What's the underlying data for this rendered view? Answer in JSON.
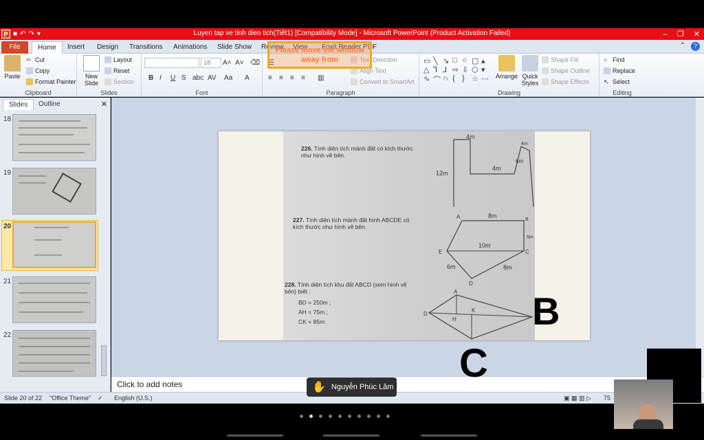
{
  "window": {
    "title": "Luyen tap ve tinh dien tich(Tiết1) [Compatibility Mode] - Microsoft PowerPoint (Product Activation Failed)",
    "app_logo": "P"
  },
  "ribbon_tabs": [
    "File",
    "Home",
    "Insert",
    "Design",
    "Transitions",
    "Animations",
    "Slide Show",
    "Review",
    "View",
    "Foxit Reader PDF"
  ],
  "clipboard": {
    "paste": "Paste",
    "cut": "Cut",
    "copy": "Copy",
    "format_painter": "Format Painter",
    "label": "Clipboard"
  },
  "slides_group": {
    "new_slide": "New Slide",
    "layout": "Layout",
    "reset": "Reset",
    "section": "Section",
    "label": "Slides"
  },
  "font_group": {
    "size": "18",
    "label": "Font"
  },
  "paragraph_group": {
    "text_direction": "Text Direction",
    "align_text": "Align Text",
    "convert": "Convert to SmartArt",
    "label": "Paragraph"
  },
  "drawing_group": {
    "arrange": "Arrange",
    "quick_styles": "Quick Styles",
    "shape_fill": "Shape Fill",
    "shape_outline": "Shape Outline",
    "shape_effects": "Shape Effects",
    "label": "Drawing"
  },
  "editing_group": {
    "find": "Find",
    "replace": "Replace",
    "select": "Select",
    "label": "Editing"
  },
  "slide_pane": {
    "tabs": [
      "Slides",
      "Outline"
    ],
    "thumbnails": [
      {
        "num": "18"
      },
      {
        "num": "19"
      },
      {
        "num": "20"
      },
      {
        "num": "21"
      },
      {
        "num": "22"
      }
    ]
  },
  "slide": {
    "p226": {
      "num": "226.",
      "text": "Tính diện tích mảnh đất có kích thước như hình vẽ bên."
    },
    "p227": {
      "num": "227.",
      "text": "Tính diện tích mảnh đất hình ABCDE có kích thước như hình vẽ bên."
    },
    "p228": {
      "num": "228.",
      "text": "Tính diện tích khu đất ABCD (xem hình vẽ bên) biết :",
      "l1": "BD = 250m ;",
      "l2": "AH = 75m ;",
      "l3": "CK = 85m."
    },
    "fig1": {
      "top": "4m",
      "right1": "4m",
      "right2": "6m",
      "mid": "4m",
      "inner": "6m",
      "left": "12m"
    },
    "fig2": {
      "A": "A",
      "B": "B",
      "C": "C",
      "D": "D",
      "E": "E",
      "top": "8m",
      "mid": "10m",
      "left": "6m",
      "right": "8m",
      "side": "5m"
    },
    "fig3": {
      "A": "A",
      "B": "B",
      "C": "C",
      "D": "D",
      "H": "H",
      "K": "K"
    }
  },
  "notes_placeholder": "Click to add notes",
  "status": {
    "slide": "Slide 20 of 22",
    "theme": "\"Office Theme\"",
    "language": "English (U.S.)",
    "zoom": "75"
  },
  "overlay": {
    "raise_hand_name": "Nguyễn Phúc Lâm",
    "big_b": "B",
    "big_c": "C",
    "warning": "Please move the window away from"
  }
}
